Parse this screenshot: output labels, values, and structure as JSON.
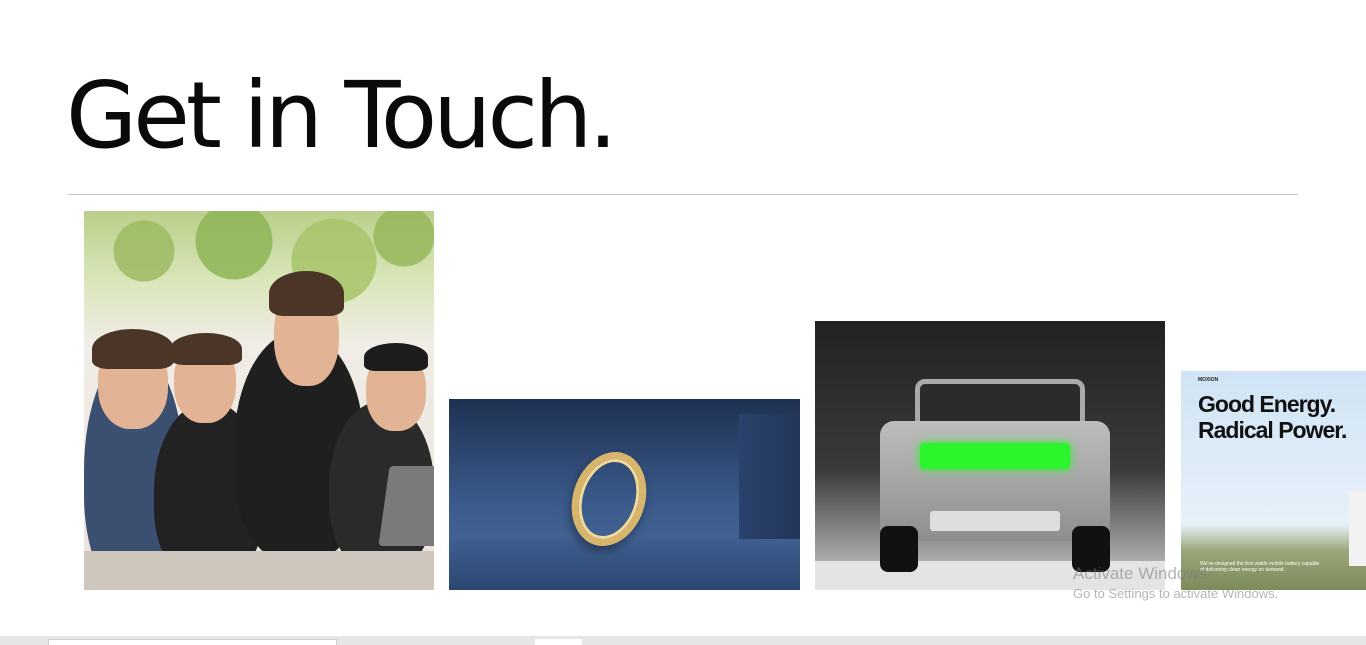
{
  "page": {
    "heading": "Get in Touch."
  },
  "gallery": {
    "ad": {
      "brand": "MOXION",
      "headline_line1": "Good Energy.",
      "headline_line2": "Radical Power.",
      "body": "We've designed the first viable mobile battery capable of delivering clean energy on demand."
    }
  },
  "watermark": {
    "title": "Activate Windows",
    "subtitle": "Go to Settings to activate Windows."
  },
  "colors": {
    "text": "#0a0a0a",
    "divider": "#c8c8c8",
    "truck_light": "#2cf52c",
    "ring_gold": "#d8b56d"
  }
}
